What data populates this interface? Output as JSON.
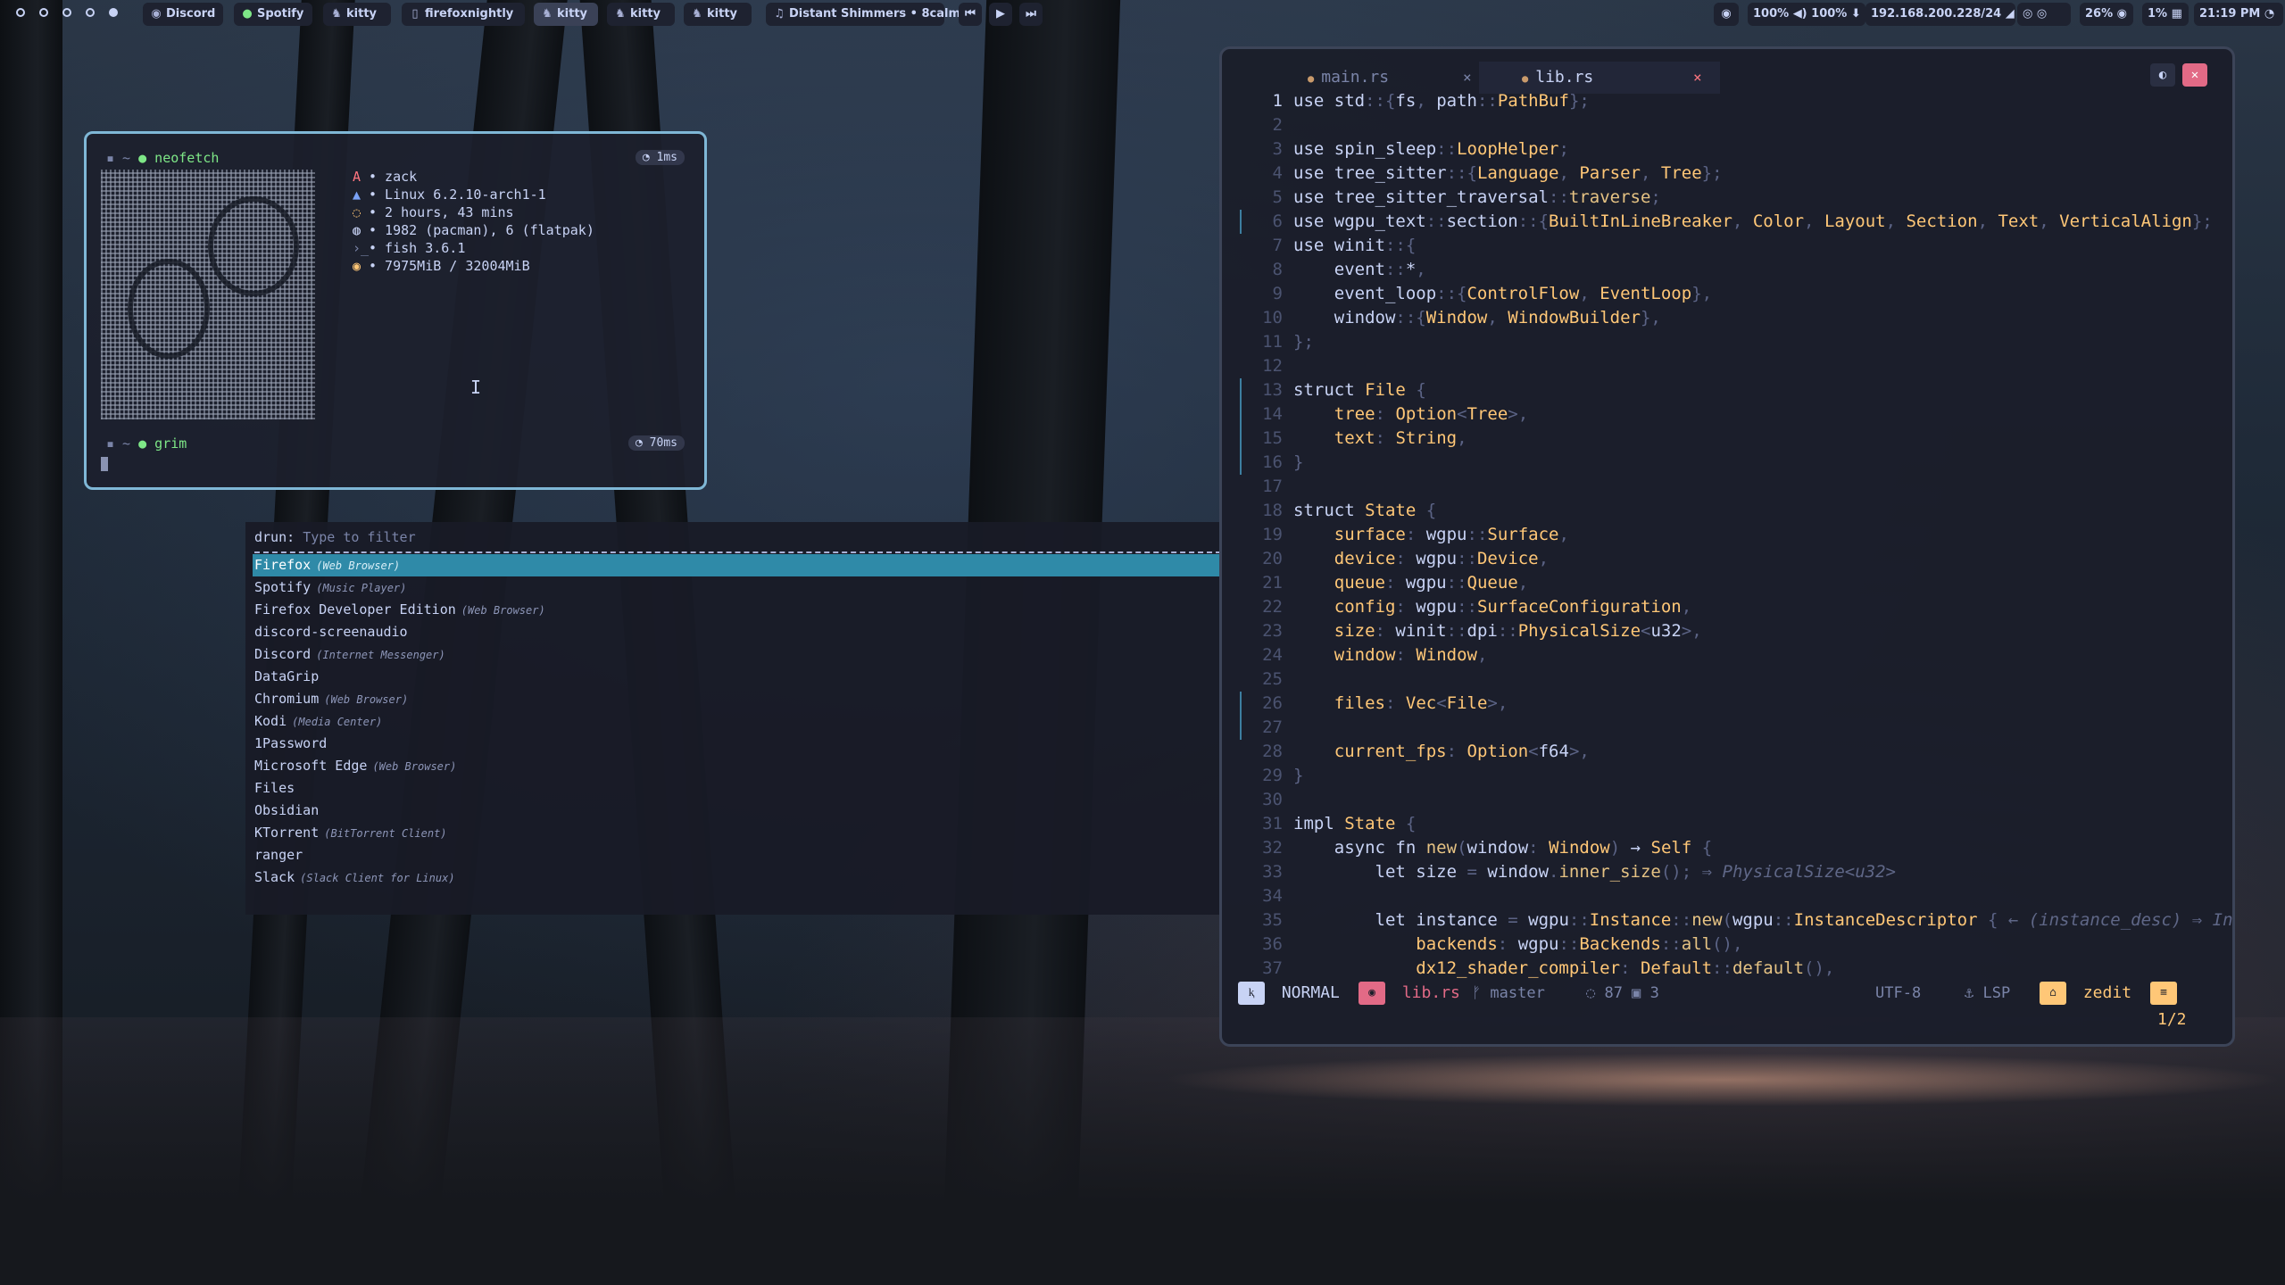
{
  "topbar": {
    "workspaces": [
      "ws1",
      "ws2",
      "ws3",
      "ws4",
      "ws5"
    ],
    "apps": [
      {
        "icon": "discord-icon",
        "label": "Discord"
      },
      {
        "icon": "spotify-icon",
        "label": "Spotify"
      },
      {
        "icon": "kitty-icon",
        "label": "kitty"
      },
      {
        "icon": "firefox-icon",
        "label": "firefoxnightly"
      },
      {
        "icon": "kitty-icon",
        "label": "kitty"
      },
      {
        "icon": "kitty-icon",
        "label": "kitty"
      },
      {
        "icon": "kitty-icon",
        "label": "kitty"
      }
    ],
    "media_title": "Distant Shimmers • 8calm",
    "media_prev": "⏮",
    "media_play": "▶",
    "media_next": "⏭",
    "eye_icon": "◉",
    "volume": "100% ◀) 100% ⬇",
    "network": "192.168.200.228/24 ◢",
    "tray": "◎ ◎",
    "cpu": "26% ◉",
    "mem": "1% ▦",
    "clock": "21:19 PM ◔"
  },
  "terminal": {
    "prompt1_dir": "▪ ~",
    "prompt1_cmd": "● neofetch",
    "prompt1_time": "◔ 1ms",
    "info": [
      {
        "icon": "A",
        "text": "• zack"
      },
      {
        "icon": "▲",
        "text": "• Linux 6.2.10-arch1-1"
      },
      {
        "icon": "◌",
        "text": "• 2 hours, 43 mins"
      },
      {
        "icon": "◍",
        "text": "• 1982 (pacman), 6 (flatpak)"
      },
      {
        "icon": "›_",
        "text": "• fish 3.6.1"
      },
      {
        "icon": "◉",
        "text": "• 7975MiB / 32004MiB"
      }
    ],
    "prompt2_dir": "▪ ~",
    "prompt2_cmd": "● grim",
    "prompt2_time": "◔ 70ms",
    "cursor_glyph": "I"
  },
  "launcher": {
    "mode": "drun:",
    "placeholder": "Type to filter",
    "items": [
      {
        "name": "Firefox",
        "sub": "(Web Browser)",
        "selected": true
      },
      {
        "name": "Spotify",
        "sub": "(Music Player)"
      },
      {
        "name": "Firefox Developer Edition",
        "sub": "(Web Browser)"
      },
      {
        "name": "discord-screenaudio",
        "sub": ""
      },
      {
        "name": "Discord",
        "sub": "(Internet Messenger)"
      },
      {
        "name": "DataGrip",
        "sub": ""
      },
      {
        "name": "Chromium",
        "sub": "(Web Browser)"
      },
      {
        "name": "Kodi",
        "sub": "(Media Center)"
      },
      {
        "name": "1Password",
        "sub": ""
      },
      {
        "name": "Microsoft Edge",
        "sub": "(Web Browser)"
      },
      {
        "name": "Files",
        "sub": ""
      },
      {
        "name": "Obsidian",
        "sub": ""
      },
      {
        "name": "KTorrent",
        "sub": "(BitTorrent Client)"
      },
      {
        "name": "ranger",
        "sub": ""
      },
      {
        "name": "Slack",
        "sub": "(Slack Client for Linux)"
      }
    ]
  },
  "editor": {
    "tabs": [
      {
        "name": "main.rs",
        "active": false,
        "close": "×"
      },
      {
        "name": "lib.rs",
        "active": true,
        "close": "×"
      }
    ],
    "tab_marker": "●",
    "btn_split": "◐",
    "btn_close": "✕",
    "lines": [
      {
        "n": "1",
        "cur": true,
        "html": "<span class='kw'>use</span> std<span class='pn'>::{</span>fs<span class='pn'>,</span> path<span class='pn'>::</span><span class='ty'>PathBuf</span><span class='pn'>};</span>"
      },
      {
        "n": "2",
        "html": ""
      },
      {
        "n": "3",
        "html": "<span class='kw'>use</span> spin_sleep<span class='pn'>::</span><span class='ty'>LoopHelper</span><span class='pn'>;</span>"
      },
      {
        "n": "4",
        "html": "<span class='kw'>use</span> tree_sitter<span class='pn'>::{</span><span class='ty'>Language</span><span class='pn'>,</span> <span class='ty'>Parser</span><span class='pn'>,</span> <span class='ty'>Tree</span><span class='pn'>};</span>"
      },
      {
        "n": "5",
        "html": "<span class='kw'>use</span> tree_sitter_traversal<span class='pn'>::</span><span class='fn'>traverse</span><span class='pn'>;</span>"
      },
      {
        "n": "6",
        "gut": true,
        "html": "<span class='kw'>use</span> wgpu_text<span class='pn'>::</span>section<span class='pn'>::{</span><span class='ty'>BuiltInLineBreaker</span><span class='pn'>,</span> <span class='ty'>Color</span><span class='pn'>,</span> <span class='ty'>Layout</span><span class='pn'>,</span> <span class='ty'>Section</span><span class='pn'>,</span> <span class='ty'>Text</span><span class='pn'>,</span> <span class='ty'>VerticalAlign</span><span class='pn'>};</span>"
      },
      {
        "n": "7",
        "html": "<span class='kw'>use</span> winit<span class='pn'>::{</span>"
      },
      {
        "n": "8",
        "html": "    event<span class='pn'>::</span>*<span class='pn'>,</span>"
      },
      {
        "n": "9",
        "html": "    event_loop<span class='pn'>::{</span><span class='ty'>ControlFlow</span><span class='pn'>,</span> <span class='ty'>EventLoop</span><span class='pn'>},</span>"
      },
      {
        "n": "10",
        "html": "    window<span class='pn'>::{</span><span class='ty'>Window</span><span class='pn'>,</span> <span class='ty'>WindowBuilder</span><span class='pn'>},</span>"
      },
      {
        "n": "11",
        "html": "<span class='pn'>};</span>"
      },
      {
        "n": "12",
        "html": ""
      },
      {
        "n": "13",
        "gut": true,
        "html": "<span class='kw'>struct</span> <span class='ty'>File</span> <span class='pn'>{</span>"
      },
      {
        "n": "14",
        "gut": true,
        "html": "    <span class='fld'>tree</span><span class='pn'>:</span> <span class='ty'>Option</span><span class='pn'>&lt;</span><span class='ty'>Tree</span><span class='pn'>&gt;,</span>"
      },
      {
        "n": "15",
        "gut": true,
        "html": "    <span class='fld'>text</span><span class='pn'>:</span> <span class='ty'>String</span><span class='pn'>,</span>"
      },
      {
        "n": "16",
        "gut": true,
        "html": "<span class='pn'>}</span>"
      },
      {
        "n": "17",
        "html": ""
      },
      {
        "n": "18",
        "html": "<span class='kw'>struct</span> <span class='ty'>State</span> <span class='pn'>{</span>"
      },
      {
        "n": "19",
        "html": "    <span class='fld'>surface</span><span class='pn'>:</span> wgpu<span class='pn'>::</span><span class='ty'>Surface</span><span class='pn'>,</span>"
      },
      {
        "n": "20",
        "html": "    <span class='fld'>device</span><span class='pn'>:</span> wgpu<span class='pn'>::</span><span class='ty'>Device</span><span class='pn'>,</span>"
      },
      {
        "n": "21",
        "html": "    <span class='fld'>queue</span><span class='pn'>:</span> wgpu<span class='pn'>::</span><span class='ty'>Queue</span><span class='pn'>,</span>"
      },
      {
        "n": "22",
        "html": "    <span class='fld'>config</span><span class='pn'>:</span> wgpu<span class='pn'>::</span><span class='ty'>SurfaceConfiguration</span><span class='pn'>,</span>"
      },
      {
        "n": "23",
        "html": "    <span class='fld'>size</span><span class='pn'>:</span> winit<span class='pn'>::</span>dpi<span class='pn'>::</span><span class='ty'>PhysicalSize</span><span class='pn'>&lt;</span>u32<span class='pn'>&gt;,</span>"
      },
      {
        "n": "24",
        "html": "    <span class='fld'>window</span><span class='pn'>:</span> <span class='ty'>Window</span><span class='pn'>,</span>"
      },
      {
        "n": "25",
        "html": ""
      },
      {
        "n": "26",
        "gut": true,
        "html": "    <span class='fld'>files</span><span class='pn'>:</span> <span class='ty'>Vec</span><span class='pn'>&lt;</span><span class='ty'>File</span><span class='pn'>&gt;,</span>"
      },
      {
        "n": "27",
        "gut": true,
        "html": ""
      },
      {
        "n": "28",
        "html": "    <span class='fld'>current_fps</span><span class='pn'>:</span> <span class='ty'>Option</span><span class='pn'>&lt;</span>f64<span class='pn'>&gt;,</span>"
      },
      {
        "n": "29",
        "html": "<span class='pn'>}</span>"
      },
      {
        "n": "30",
        "html": ""
      },
      {
        "n": "31",
        "html": "<span class='kw'>impl</span> <span class='ty'>State</span> <span class='pn'>{</span>"
      },
      {
        "n": "32",
        "html": "    <span class='kw'>async fn</span> <span class='fn'>new</span><span class='pn'>(</span>window<span class='pn'>:</span> <span class='ty'>Window</span><span class='pn'>)</span> <span class='kw'>→</span> <span class='ty'>Self</span> <span class='pn'>{</span>"
      },
      {
        "n": "33",
        "html": "        <span class='kw'>let</span> size <span class='pn'>=</span> window<span class='pn'>.</span><span class='fn'>inner_size</span><span class='pn'>();</span> <span class='hint'>⇒ PhysicalSize&lt;u32&gt;</span>"
      },
      {
        "n": "34",
        "html": ""
      },
      {
        "n": "35",
        "html": "        <span class='kw'>let</span> instance <span class='pn'>=</span> wgpu<span class='pn'>::</span><span class='ty'>Instance</span><span class='pn'>::</span><span class='fn'>new</span><span class='pn'>(</span>wgpu<span class='pn'>::</span><span class='ty'>InstanceDescriptor</span> <span class='pn'>{</span> <span class='hint'>← (instance_desc) ⇒ In</span>"
      },
      {
        "n": "36",
        "html": "            <span class='fld'>backends</span><span class='pn'>:</span> wgpu<span class='pn'>::</span><span class='ty'>Backends</span><span class='pn'>::</span><span class='fn'>all</span><span class='pn'>(),</span>"
      },
      {
        "n": "37",
        "html": "            <span class='fld'>dx12_shader_compiler</span><span class='pn'>:</span> <span class='ty'>Default</span><span class='pn'>::</span><span class='fn'>default</span><span class='pn'>(),</span>"
      }
    ],
    "status": {
      "mode_icon": "ⱪ",
      "mode": "NORMAL",
      "file_icon": "◉",
      "file": "lib.rs",
      "branch": "ᚠ master",
      "diag": "◌ 87 ▣ 3",
      "encoding": "UTF-8",
      "lsp": "⚓ LSP",
      "editor_icon": "⌂",
      "editor_name": "zedit",
      "pos_icon": "≡",
      "pos": "1/2"
    }
  }
}
